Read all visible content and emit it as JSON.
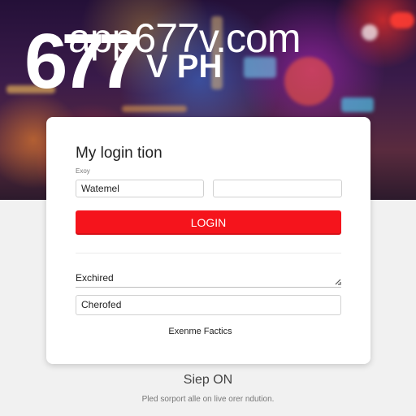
{
  "header": {
    "brand_big": "677",
    "brand_sub": "V PH",
    "site_url": "app677v.com"
  },
  "login_card": {
    "title": "My login tion",
    "field_caption": "Exoy",
    "username_value": "Watemel",
    "password_value": "",
    "login_label": "LOGIN",
    "select_label": "Exchired",
    "third_field_value": "Cherofed",
    "footer_link": "Exenme Factics"
  },
  "bottom": {
    "title": "Siep ON",
    "note": "Pled sorport alle on live orer ndution."
  },
  "colors": {
    "accent_red": "#f5141c",
    "card_bg": "#ffffff",
    "page_bg": "#f1f1f1"
  },
  "icons": {
    "select_arrow": "chevron-down-icon"
  }
}
